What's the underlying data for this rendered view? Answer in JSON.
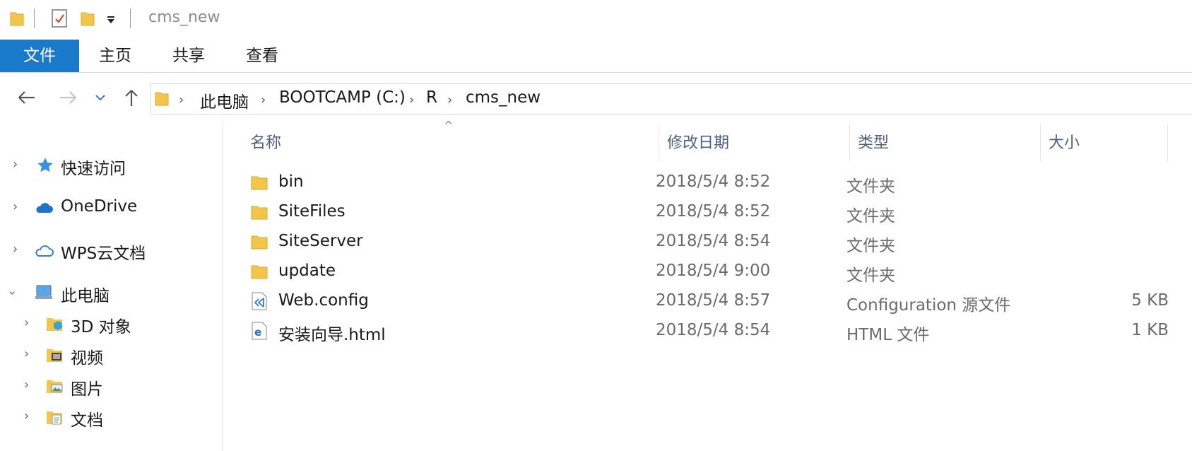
{
  "window": {
    "title": "cms_new"
  },
  "ribbon": {
    "tabs": [
      {
        "label": "文件",
        "active": true
      },
      {
        "label": "主页"
      },
      {
        "label": "共享"
      },
      {
        "label": "查看"
      }
    ]
  },
  "address": {
    "crumbs": [
      "此电脑",
      "BOOTCAMP (C:)",
      "R",
      "cms_new"
    ]
  },
  "navpane": {
    "items": [
      {
        "label": "快速访问",
        "icon": "star-icon",
        "expanded": false
      },
      {
        "label": "OneDrive",
        "icon": "cloud-icon",
        "expanded": false
      },
      {
        "label": "WPS云文档",
        "icon": "cloud-outline-icon",
        "expanded": false
      },
      {
        "label": "此电脑",
        "icon": "computer-icon",
        "expanded": true
      },
      {
        "label": "3D 对象",
        "icon": "3d-objects-icon",
        "expanded": false
      },
      {
        "label": "视频",
        "icon": "video-folder-icon",
        "expanded": false
      },
      {
        "label": "图片",
        "icon": "pictures-folder-icon",
        "expanded": false
      },
      {
        "label": "文档",
        "icon": "documents-folder-icon",
        "expanded": false
      }
    ]
  },
  "columns": {
    "name": "名称",
    "date": "修改日期",
    "type": "类型",
    "size": "大小"
  },
  "files": [
    {
      "name": "bin",
      "date": "2018/5/4 8:52",
      "type": "文件夹",
      "size": "",
      "icon": "folder-icon"
    },
    {
      "name": "SiteFiles",
      "date": "2018/5/4 8:52",
      "type": "文件夹",
      "size": "",
      "icon": "folder-icon"
    },
    {
      "name": "SiteServer",
      "date": "2018/5/4 8:54",
      "type": "文件夹",
      "size": "",
      "icon": "folder-icon"
    },
    {
      "name": "update",
      "date": "2018/5/4 9:00",
      "type": "文件夹",
      "size": "",
      "icon": "folder-icon"
    },
    {
      "name": "Web.config",
      "date": "2018/5/4 8:57",
      "type": "Configuration 源文件",
      "size": "5 KB",
      "icon": "config-file-icon"
    },
    {
      "name": "安装向导.html",
      "date": "2018/5/4 8:54",
      "type": "HTML 文件",
      "size": "1 KB",
      "icon": "html-file-icon"
    }
  ],
  "colors": {
    "accent": "#1979ca",
    "folder": "#f3c54a",
    "header_text": "#4d6082"
  }
}
